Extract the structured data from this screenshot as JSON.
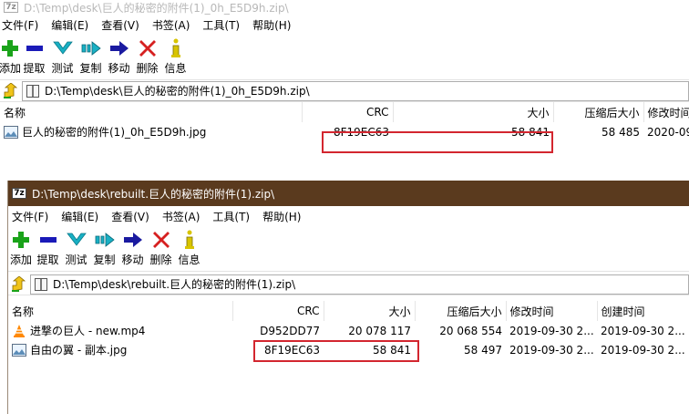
{
  "window1": {
    "title": "D:\\Temp\\desk\\巨人的秘密的附件(1)_0h_E5D9h.zip\\",
    "menu": [
      "文件(F)",
      "编辑(E)",
      "查看(V)",
      "书签(A)",
      "工具(T)",
      "帮助(H)"
    ],
    "toolbar": [
      "添加",
      "提取",
      "测试",
      "复制",
      "移动",
      "删除",
      "信息"
    ],
    "address": "D:\\Temp\\desk\\巨人的秘密的附件(1)_0h_E5D9h.zip\\",
    "columns": [
      "名称",
      "CRC",
      "大小",
      "压缩后大小",
      "修改时间"
    ],
    "rows": [
      {
        "name": "巨人的秘密的附件(1)_0h_E5D9h.jpg",
        "crc": "8F19EC63",
        "size": "58 841",
        "packed": "58 485",
        "modified": "2020-09"
      }
    ]
  },
  "window2": {
    "logo": "7z",
    "title": "D:\\Temp\\desk\\rebuilt.巨人的秘密的附件(1).zip\\",
    "menu": [
      "文件(F)",
      "编辑(E)",
      "查看(V)",
      "书签(A)",
      "工具(T)",
      "帮助(H)"
    ],
    "toolbar": [
      "添加",
      "提取",
      "测试",
      "复制",
      "移动",
      "删除",
      "信息"
    ],
    "address": "D:\\Temp\\desk\\rebuilt.巨人的秘密的附件(1).zip\\",
    "columns": [
      "名称",
      "CRC",
      "大小",
      "压缩后大小",
      "修改时间",
      "创建时间"
    ],
    "rows": [
      {
        "name": "进撃の巨人 - new.mp4",
        "crc": "D952DD77",
        "size": "20 078 117",
        "packed": "20 068 554",
        "modified": "2019-09-30 2...",
        "created": "2019-09-30 2..."
      },
      {
        "name": "自由の翼 - 副本.jpg",
        "crc": "8F19EC63",
        "size": "58 841",
        "packed": "58 497",
        "modified": "2019-09-30 2...",
        "created": "2019-09-30 2..."
      }
    ]
  },
  "colors": {
    "highlight": "#d3262f",
    "titlebar": "#5a3a1e",
    "add": "#1aa31a",
    "remove": "#1a1ab8",
    "test": "#19b0c4",
    "delete": "#d62020"
  }
}
